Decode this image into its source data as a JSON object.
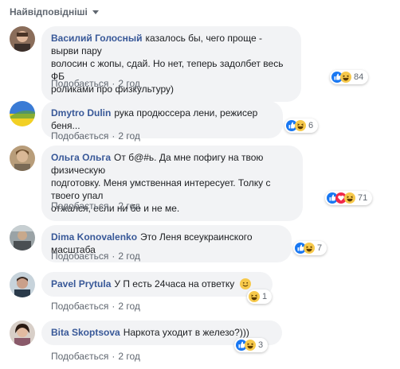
{
  "sort": {
    "label": "Найвідповідніші"
  },
  "comments": [
    {
      "name": "Василий Голосный",
      "text_lines": [
        "казалось бы, чего проще - вырви пару",
        "волосин с жопы, сдай. Но нет, теперь задолбет весь ФБ",
        "роликами про физкультуру)"
      ],
      "like": "Подобається",
      "time": "2 год",
      "reactions": [
        "like",
        "haha"
      ],
      "count": "84"
    },
    {
      "name": "Dmytro Dulin",
      "text_lines": [
        "рука продюссера лени, режисер беня..."
      ],
      "like": "Подобається",
      "time": "2 год",
      "reactions": [
        "like",
        "haha"
      ],
      "count": "6"
    },
    {
      "name": "Ольга Ольга",
      "text_lines": [
        "От б@#ь. Да мне пофигу на твою физическую",
        "подготовку. Меня умственная интересует. Толку с твоего упал",
        "отжался, если ни бе и не ме."
      ],
      "like": "Подобається",
      "time": "2 год",
      "reactions": [
        "like",
        "love",
        "haha"
      ],
      "count": "71"
    },
    {
      "name": "Dima Konovalenko",
      "text_lines": [
        "Это Леня всеукраинского масштаба"
      ],
      "like": "Подобається",
      "time": "2 год",
      "reactions": [
        "like",
        "haha"
      ],
      "count": "7"
    },
    {
      "name": "Pavel Prytula",
      "text_lines": [
        "У П есть 24часа на ответку"
      ],
      "like": "Подобається",
      "time": "2 год",
      "reactions": [
        "haha"
      ],
      "count": "1"
    },
    {
      "name": "Bita Skoptsova",
      "text_lines": [
        "Наркота уходит в железо?)))"
      ],
      "like": "Подобається",
      "time": "2 год",
      "reactions": [
        "like",
        "haha"
      ],
      "count": "3"
    }
  ]
}
